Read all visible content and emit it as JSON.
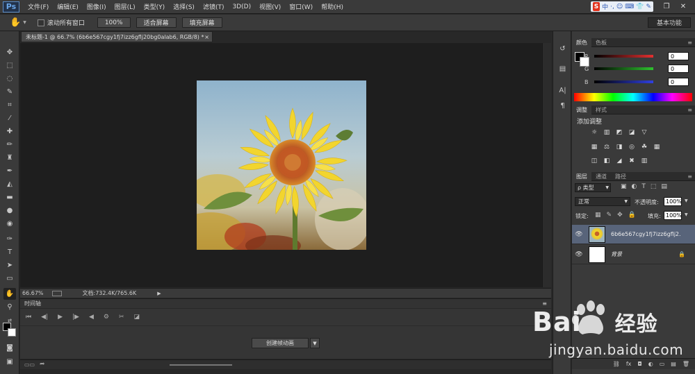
{
  "app": {
    "logo": "Ps",
    "menus": [
      "文件(F)",
      "编辑(E)",
      "图像(I)",
      "图层(L)",
      "类型(Y)",
      "选择(S)",
      "滤镜(T)",
      "3D(D)",
      "视图(V)",
      "窗口(W)",
      "帮助(H)"
    ],
    "ime": {
      "badge": "S",
      "items": [
        "中",
        "·,",
        "☺",
        "⌨",
        "👕",
        "✎"
      ]
    },
    "window_buttons": [
      "–",
      "❐",
      "✕"
    ]
  },
  "options": {
    "tool_icon": "hand-icon",
    "scroll_all_label": "滚动所有窗口",
    "btn_100": "100%",
    "btn_fit": "适合屏幕",
    "btn_fill": "填充屏幕",
    "workspace": "基本功能"
  },
  "document": {
    "tab_title": "未标题-1 @ 66.7% (6b6e567cgy1fj7izz6gflj20bg0alab6, RGB/8) *",
    "close": "×",
    "zoom": "66.67%",
    "doc_size": "文档:732.4K/765.6K"
  },
  "timeline": {
    "title": "时间轴",
    "controls": [
      "⏮",
      "◀|",
      "▶",
      "|▶",
      "◀",
      "⚙",
      "✂",
      "◪"
    ],
    "create_button": "创建帧动画",
    "dropdown": "▼"
  },
  "color_panel": {
    "tabs": [
      "颜色",
      "色板"
    ],
    "sliders": [
      {
        "label": "R",
        "value": "0",
        "color": "#e23030"
      },
      {
        "label": "G",
        "value": "0",
        "color": "#2ec12e"
      },
      {
        "label": "B",
        "value": "0",
        "color": "#3040e0"
      }
    ]
  },
  "adjust_panel": {
    "tabs": [
      "调整",
      "样式"
    ],
    "title": "添加调整",
    "row1": [
      "☼",
      "▥",
      "◩",
      "◪",
      "▽"
    ],
    "row2": [
      "▦",
      "⚖",
      "◨",
      "◎",
      "☘",
      "▦"
    ],
    "row3": [
      "◫",
      "◧",
      "◢",
      "✖",
      "▥"
    ]
  },
  "layers_panel": {
    "tabs": [
      "图层",
      "通道",
      "路径"
    ],
    "filter_label": "ρ 类型",
    "blend_mode": "正常",
    "opacity_label": "不透明度:",
    "opacity_value": "100%",
    "lock_label": "锁定:",
    "fill_label": "填充:",
    "fill_value": "100%",
    "layers": [
      {
        "name": "6b6e567cgy1fj7izz6gflj2...",
        "selected": true
      },
      {
        "name": "背景",
        "selected": false,
        "locked": true
      }
    ],
    "footer_icons": [
      "⛓",
      "fx",
      "◘",
      "◐",
      "▭",
      "▤",
      "🗑"
    ]
  },
  "watermark": {
    "brand_left": "Bai",
    "brand_right": "经验",
    "url": "jingyan.baidu.com"
  }
}
